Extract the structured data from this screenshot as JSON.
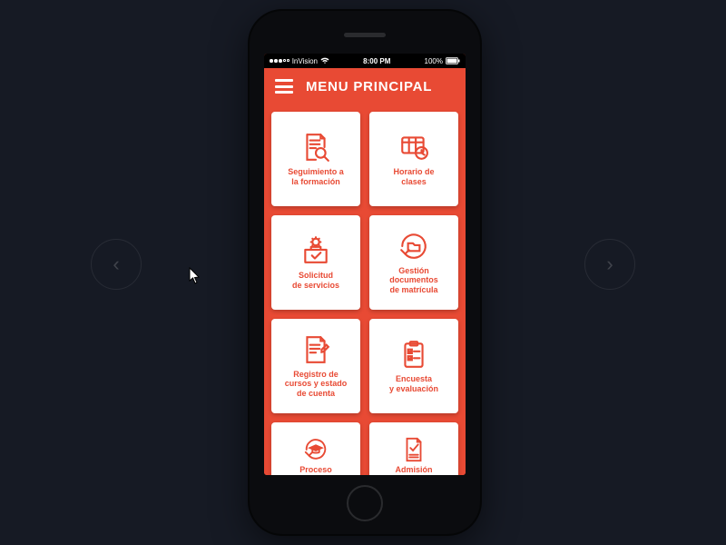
{
  "status_bar": {
    "carrier": "InVision",
    "time": "8:00 PM",
    "battery_text": "100%"
  },
  "header": {
    "title": "MENU PRINCIPAL"
  },
  "cards": [
    {
      "label": "Seguimiento a\nla formación"
    },
    {
      "label": "Horario de\nclases"
    },
    {
      "label": "Solicitud\nde servicios"
    },
    {
      "label": "Gestión\ndocumentos\nde matrícula"
    },
    {
      "label": "Registro de\ncursos y estado\nde cuenta"
    },
    {
      "label": "Encuesta\ny evaluación"
    },
    {
      "label": "Proceso"
    },
    {
      "label": "Admisión"
    }
  ],
  "nav": {
    "prev": "‹",
    "next": "›"
  }
}
